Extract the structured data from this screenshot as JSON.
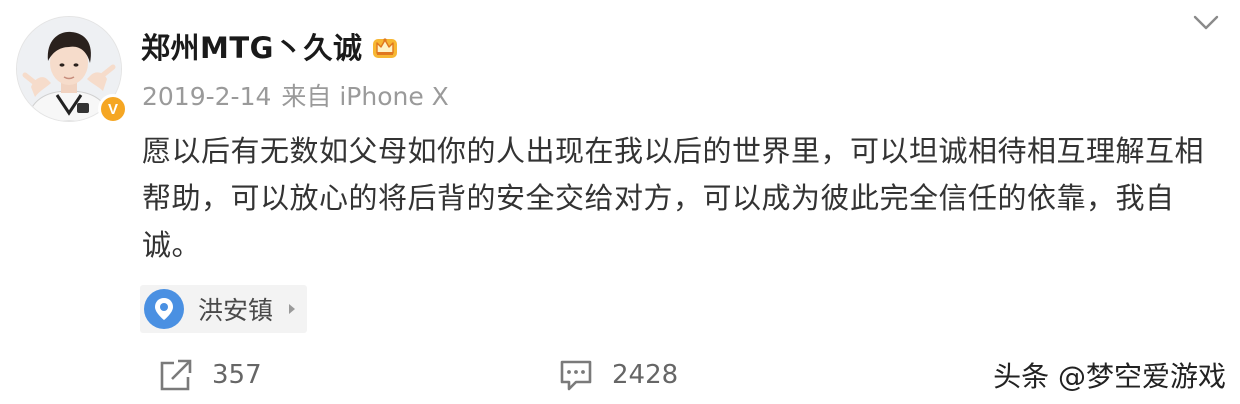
{
  "post": {
    "username": "郑州MTG丶久诚",
    "date": "2019-2-14",
    "source": "来自 iPhone X",
    "text": "愿以后有无数如父母如你的人出现在我以后的世界里，可以坦诚相待相互理解互相帮助，可以放心的将后背的安全交给对方，可以成为彼此完全信任的依靠，我自诚。",
    "location": "洪安镇",
    "verified_badge": "V",
    "user_badge_icon": "crown-icon",
    "menu_icon": "chevron-down-icon"
  },
  "actions": {
    "repost": {
      "icon": "share-icon",
      "count": "357"
    },
    "comment": {
      "icon": "comment-icon",
      "count": "2428"
    }
  },
  "watermark": "头条 @梦空爱游戏",
  "colors": {
    "badge_orange": "#f5a623",
    "location_blue": "#4a90e2",
    "meta_gray": "#9a9a9a"
  }
}
